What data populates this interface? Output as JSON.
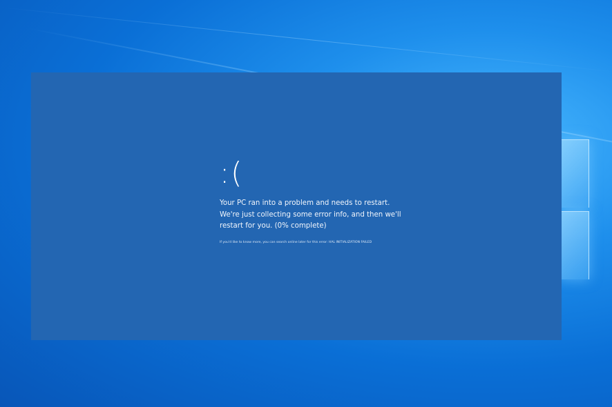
{
  "bsod": {
    "face": ":(",
    "message": "Your PC ran into a problem and needs to restart. We're just collecting some error info, and then we'll restart for you. (0% complete)",
    "info_prefix": "If you'd like to know more, you can search online later for this error:",
    "stop_code": "HAL INITIALIZATION FAILED"
  },
  "colors": {
    "bsod_background": "#2366b2",
    "desktop_accent": "#1e8fec"
  }
}
